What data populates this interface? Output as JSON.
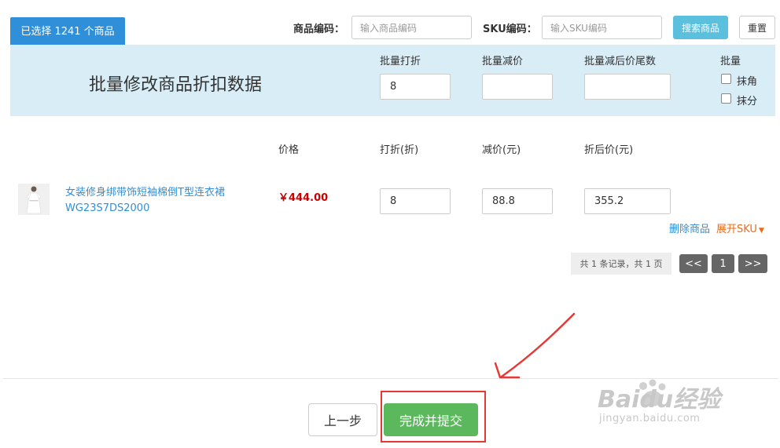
{
  "header": {
    "selected_tab": "已选择 1241 个商品",
    "product_code_label": "商品编码：",
    "product_code_placeholder": "输入商品编码",
    "sku_code_label": "SKU编码：",
    "sku_code_placeholder": "输入SKU编码",
    "search_button": "搜索商品",
    "reset_button": "重置"
  },
  "batch": {
    "title": "批量修改商品折扣数据",
    "discount_label": "批量打折",
    "discount_value": "8",
    "reduce_label": "批量减价",
    "reduce_value": "",
    "tail_label": "批量减后价尾数",
    "tail_value": "",
    "batch_label": "批量",
    "round_jiao": "抹角",
    "round_fen": "抹分"
  },
  "table": {
    "headers": {
      "price": "价格",
      "discount": "打折(折)",
      "reduce": "减价(元)",
      "after": "折后价(元)"
    },
    "rows": [
      {
        "name": "女装修身绑带饰短袖棉倒T型连衣裙WG23S7DS2000",
        "price": "￥444.00",
        "discount": "8",
        "reduce": "88.8",
        "after": "355.2",
        "delete_link": "删除商品",
        "expand_link": "展开SKU"
      }
    ]
  },
  "pager": {
    "info": "共 1 条记录，共 1 页",
    "first": "<<",
    "current": "1",
    "last": ">>"
  },
  "footer": {
    "prev_button": "上一步",
    "submit_button": "完成并提交"
  },
  "watermark": {
    "brand": "Baidu经验",
    "url": "jingyan.baidu.com"
  },
  "colors": {
    "accent_blue": "#2f8fd8",
    "panel_bg": "#d9edf7",
    "price_red": "#cc0000",
    "submit_green": "#5cb85c",
    "annotation_red": "#e53935"
  }
}
